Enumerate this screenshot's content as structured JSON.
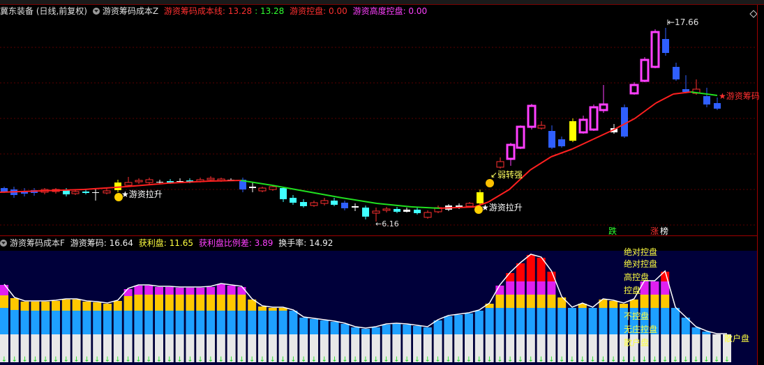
{
  "main_header": {
    "stock": "冀东装备 (日线,前复权)",
    "indicator": "游资筹码成本Z",
    "cost_line_label": "游资筹码成本线: 13.28",
    "cost_line_value2": ": 13.28",
    "control_label": "游资控盘: 0.00",
    "high_control_label": "游资高度控盘: 0.00"
  },
  "sub_header": {
    "indicator": "游资筹码成本F",
    "chips_label": "游资筹码: 16.64",
    "profit_label": "获利盘: 11.65",
    "profit_diff_label": "获利盘比例差: 3.89",
    "turnover_label": "换手率: 14.92"
  },
  "annotations": {
    "high_price": "17.66",
    "low_price": "6.16",
    "pull_up_1": "游资拉升",
    "pull_up_2": "游资拉升",
    "weak_to_strong": "弱转强",
    "right_label": "★游资筹码",
    "drop_tag": "跌",
    "rise_tag": "涨",
    "list_tag": "榜"
  },
  "legend": {
    "items": [
      "绝对控盘",
      "绝对控盘",
      "高控盘",
      "控盘",
      "不控盘",
      "无庄控盘",
      "散户盘"
    ],
    "retail_label": "散户盘"
  },
  "colors": {
    "up_body": "#ff3fff",
    "down_body": "#2f5fff",
    "up_small": "#ff3030",
    "cyan": "#40ffff",
    "cost_up": "#ff2020",
    "cost_down": "#20e020",
    "header_red": "#ff3030",
    "header_green": "#30ff30",
    "header_magenta": "#ff40ff",
    "yellow": "#ffff00",
    "sub_bg": "#00003a",
    "band_white": "#e8e8e8",
    "band_blue": "#1ea0ff",
    "band_yellow": "#ffc800",
    "band_magenta": "#e020f0",
    "band_red": "#ff0000"
  },
  "chart_data": [
    {
      "type": "candlestick",
      "title": "冀东装备 (日线,前复权)",
      "low_marker": 6.16,
      "high_marker": 17.66,
      "cost_line_last": 13.28
    },
    {
      "type": "bar",
      "title": "游资筹码成本F",
      "series_names": [
        "散户盘",
        "无庄控盘",
        "不控盘",
        "控盘",
        "高控盘",
        "绝对控盘"
      ],
      "chips": 16.64,
      "profit": 11.65,
      "profit_diff": 3.89,
      "turnover": 14.92
    }
  ]
}
